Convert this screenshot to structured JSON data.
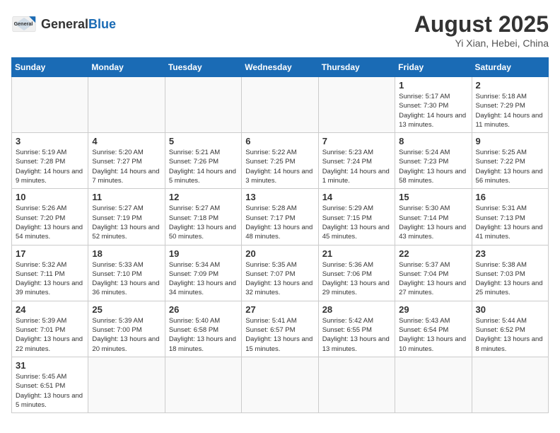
{
  "header": {
    "logo_general": "General",
    "logo_blue": "Blue",
    "month_title": "August 2025",
    "subtitle": "Yi Xian, Hebei, China"
  },
  "weekdays": [
    "Sunday",
    "Monday",
    "Tuesday",
    "Wednesday",
    "Thursday",
    "Friday",
    "Saturday"
  ],
  "weeks": [
    [
      {
        "day": "",
        "info": ""
      },
      {
        "day": "",
        "info": ""
      },
      {
        "day": "",
        "info": ""
      },
      {
        "day": "",
        "info": ""
      },
      {
        "day": "",
        "info": ""
      },
      {
        "day": "1",
        "info": "Sunrise: 5:17 AM\nSunset: 7:30 PM\nDaylight: 14 hours and 13 minutes."
      },
      {
        "day": "2",
        "info": "Sunrise: 5:18 AM\nSunset: 7:29 PM\nDaylight: 14 hours and 11 minutes."
      }
    ],
    [
      {
        "day": "3",
        "info": "Sunrise: 5:19 AM\nSunset: 7:28 PM\nDaylight: 14 hours and 9 minutes."
      },
      {
        "day": "4",
        "info": "Sunrise: 5:20 AM\nSunset: 7:27 PM\nDaylight: 14 hours and 7 minutes."
      },
      {
        "day": "5",
        "info": "Sunrise: 5:21 AM\nSunset: 7:26 PM\nDaylight: 14 hours and 5 minutes."
      },
      {
        "day": "6",
        "info": "Sunrise: 5:22 AM\nSunset: 7:25 PM\nDaylight: 14 hours and 3 minutes."
      },
      {
        "day": "7",
        "info": "Sunrise: 5:23 AM\nSunset: 7:24 PM\nDaylight: 14 hours and 1 minute."
      },
      {
        "day": "8",
        "info": "Sunrise: 5:24 AM\nSunset: 7:23 PM\nDaylight: 13 hours and 58 minutes."
      },
      {
        "day": "9",
        "info": "Sunrise: 5:25 AM\nSunset: 7:22 PM\nDaylight: 13 hours and 56 minutes."
      }
    ],
    [
      {
        "day": "10",
        "info": "Sunrise: 5:26 AM\nSunset: 7:20 PM\nDaylight: 13 hours and 54 minutes."
      },
      {
        "day": "11",
        "info": "Sunrise: 5:27 AM\nSunset: 7:19 PM\nDaylight: 13 hours and 52 minutes."
      },
      {
        "day": "12",
        "info": "Sunrise: 5:27 AM\nSunset: 7:18 PM\nDaylight: 13 hours and 50 minutes."
      },
      {
        "day": "13",
        "info": "Sunrise: 5:28 AM\nSunset: 7:17 PM\nDaylight: 13 hours and 48 minutes."
      },
      {
        "day": "14",
        "info": "Sunrise: 5:29 AM\nSunset: 7:15 PM\nDaylight: 13 hours and 45 minutes."
      },
      {
        "day": "15",
        "info": "Sunrise: 5:30 AM\nSunset: 7:14 PM\nDaylight: 13 hours and 43 minutes."
      },
      {
        "day": "16",
        "info": "Sunrise: 5:31 AM\nSunset: 7:13 PM\nDaylight: 13 hours and 41 minutes."
      }
    ],
    [
      {
        "day": "17",
        "info": "Sunrise: 5:32 AM\nSunset: 7:11 PM\nDaylight: 13 hours and 39 minutes."
      },
      {
        "day": "18",
        "info": "Sunrise: 5:33 AM\nSunset: 7:10 PM\nDaylight: 13 hours and 36 minutes."
      },
      {
        "day": "19",
        "info": "Sunrise: 5:34 AM\nSunset: 7:09 PM\nDaylight: 13 hours and 34 minutes."
      },
      {
        "day": "20",
        "info": "Sunrise: 5:35 AM\nSunset: 7:07 PM\nDaylight: 13 hours and 32 minutes."
      },
      {
        "day": "21",
        "info": "Sunrise: 5:36 AM\nSunset: 7:06 PM\nDaylight: 13 hours and 29 minutes."
      },
      {
        "day": "22",
        "info": "Sunrise: 5:37 AM\nSunset: 7:04 PM\nDaylight: 13 hours and 27 minutes."
      },
      {
        "day": "23",
        "info": "Sunrise: 5:38 AM\nSunset: 7:03 PM\nDaylight: 13 hours and 25 minutes."
      }
    ],
    [
      {
        "day": "24",
        "info": "Sunrise: 5:39 AM\nSunset: 7:01 PM\nDaylight: 13 hours and 22 minutes."
      },
      {
        "day": "25",
        "info": "Sunrise: 5:39 AM\nSunset: 7:00 PM\nDaylight: 13 hours and 20 minutes."
      },
      {
        "day": "26",
        "info": "Sunrise: 5:40 AM\nSunset: 6:58 PM\nDaylight: 13 hours and 18 minutes."
      },
      {
        "day": "27",
        "info": "Sunrise: 5:41 AM\nSunset: 6:57 PM\nDaylight: 13 hours and 15 minutes."
      },
      {
        "day": "28",
        "info": "Sunrise: 5:42 AM\nSunset: 6:55 PM\nDaylight: 13 hours and 13 minutes."
      },
      {
        "day": "29",
        "info": "Sunrise: 5:43 AM\nSunset: 6:54 PM\nDaylight: 13 hours and 10 minutes."
      },
      {
        "day": "30",
        "info": "Sunrise: 5:44 AM\nSunset: 6:52 PM\nDaylight: 13 hours and 8 minutes."
      }
    ],
    [
      {
        "day": "31",
        "info": "Sunrise: 5:45 AM\nSunset: 6:51 PM\nDaylight: 13 hours and 5 minutes."
      },
      {
        "day": "",
        "info": ""
      },
      {
        "day": "",
        "info": ""
      },
      {
        "day": "",
        "info": ""
      },
      {
        "day": "",
        "info": ""
      },
      {
        "day": "",
        "info": ""
      },
      {
        "day": "",
        "info": ""
      }
    ]
  ]
}
